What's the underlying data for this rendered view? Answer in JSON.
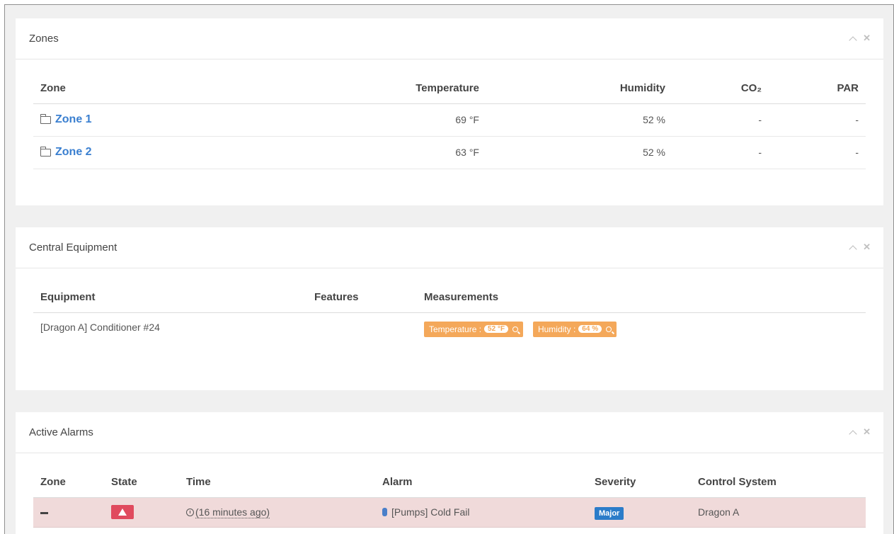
{
  "zones": {
    "title": "Zones",
    "columns": {
      "zone": "Zone",
      "temperature": "Temperature",
      "humidity": "Humidity",
      "co2": "CO₂",
      "par": "PAR"
    },
    "rows": [
      {
        "zone": "Zone 1",
        "temperature": "69 °F",
        "humidity": "52 %",
        "co2": "-",
        "par": "-"
      },
      {
        "zone": "Zone 2",
        "temperature": "63 °F",
        "humidity": "52 %",
        "co2": "-",
        "par": "-"
      }
    ]
  },
  "central": {
    "title": "Central Equipment",
    "columns": {
      "equipment": "Equipment",
      "features": "Features",
      "measurements": "Measurements"
    },
    "rows": [
      {
        "equipment": "[Dragon A] Conditioner #24",
        "measurements": [
          {
            "label": "Temperature :",
            "value": "52 °F"
          },
          {
            "label": "Humidity :",
            "value": "64 %"
          }
        ]
      }
    ]
  },
  "alarms": {
    "title": "Active Alarms",
    "columns": {
      "zone": "Zone",
      "state": "State",
      "time": "Time",
      "alarm": "Alarm",
      "severity": "Severity",
      "control": "Control System"
    },
    "rows": [
      {
        "time": "(16 minutes ago)",
        "alarm": "[Pumps] Cold Fail",
        "severity": "Major",
        "control": "Dragon A"
      }
    ]
  },
  "colors": {
    "accent": "#3a7fd0",
    "measure": "#f4a85a",
    "alarm_row": "#f0dada",
    "state": "#e04a5e",
    "severity": "#2b7cc9"
  },
  "icons": {
    "collapse": "chevron-up-icon",
    "close": "close-icon",
    "folder": "folder-icon",
    "search": "search-icon",
    "warning": "warning-icon",
    "clock": "clock-icon",
    "pump": "drop-icon"
  }
}
